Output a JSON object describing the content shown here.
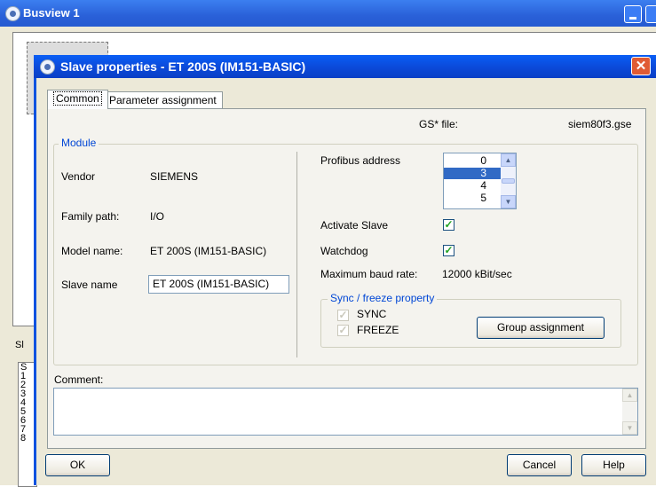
{
  "background_window": {
    "title": "Busview 1",
    "status_label": "Sl",
    "status_rows": [
      "S",
      "1",
      "2",
      "3",
      "4",
      "5",
      "6",
      "7",
      "8"
    ]
  },
  "dialog": {
    "title": "Slave properties - ET 200S (IM151-BASIC)",
    "close_glyph": "✕",
    "tabs": [
      {
        "label": "Common",
        "active": true
      },
      {
        "label": "Parameter assignment",
        "active": false
      }
    ],
    "gsd": {
      "label": "GS* file:",
      "value": "siem80f3.gse"
    },
    "module": {
      "legend": "Module",
      "vendor_label": "Vendor",
      "vendor_value": "SIEMENS",
      "family_label": "Family path:",
      "family_value": "I/O",
      "model_label": "Model name:",
      "model_value": "ET 200S (IM151-BASIC)",
      "slave_label": "Slave name",
      "slave_value": "ET 200S (IM151-BASIC)"
    },
    "profibus": {
      "label": "Profibus address",
      "options": [
        "0",
        "3",
        "4",
        "5"
      ],
      "selected": "3"
    },
    "activate_label": "Activate Slave",
    "activate_checked": true,
    "watchdog_label": "Watchdog",
    "watchdog_checked": true,
    "baud_label": "Maximum baud rate:",
    "baud_value": "12000 kBit/sec",
    "sync_freeze": {
      "legend": "Sync / freeze property",
      "sync_label": "SYNC",
      "freeze_label": "FREEZE",
      "sync_checked": true,
      "freeze_checked": true,
      "group_button": "Group assignment"
    },
    "comment_label": "Comment:",
    "comment_value": "",
    "buttons": {
      "ok": "OK",
      "cancel": "Cancel",
      "help": "Help"
    }
  },
  "colors": {
    "titlebar": "#0b49d8",
    "dialog_face": "#ece9d8",
    "selection": "#316ac5",
    "close": "#e05b34",
    "group_legend": "#0046d5"
  },
  "icons": [
    "app-icon",
    "close-icon",
    "scroll-up-icon",
    "scroll-down-icon",
    "checkmark-icon"
  ]
}
